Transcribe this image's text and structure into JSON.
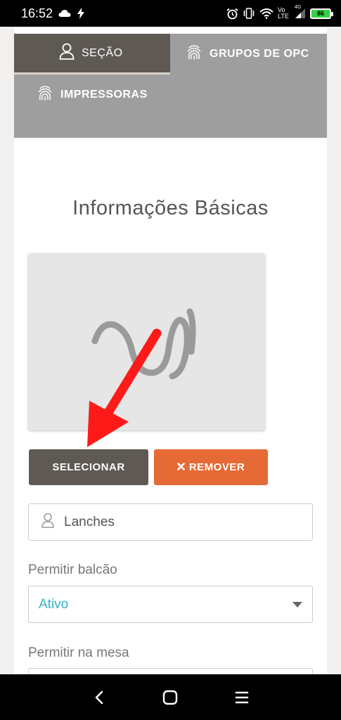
{
  "status_bar": {
    "time": "16:52",
    "network_label": "Vo LTE",
    "network_type": "4G",
    "battery": "86"
  },
  "tabs": {
    "secao": "SEÇÃO",
    "grupos": "GRUPOS DE OPC",
    "impressoras": "IMPRESSORAS"
  },
  "main": {
    "title": "Informações Básicas",
    "select_button": "SELECIONAR",
    "remove_button": "REMOVER",
    "name_value": "Lanches",
    "permitir_balcao_label": "Permitir balcão",
    "permitir_balcao_value": "Ativo",
    "permitir_mesa_label": "Permitir na mesa",
    "permitir_mesa_value": ""
  },
  "colors": {
    "tab_active": "#5f5953",
    "tab_bar": "#9e9e9e",
    "select_button": "#5f5953",
    "remove_button": "#e66a35",
    "select_value": "#3ab1c8",
    "annotation_arrow": "#ff1a1a"
  },
  "icons": [
    "cloud-icon",
    "flash-icon",
    "alarm-icon",
    "vibrate-icon",
    "wifi-icon",
    "signal-icon",
    "battery-icon",
    "user-icon",
    "fingerprint-icon",
    "image-placeholder-icon",
    "close-icon",
    "back-icon",
    "home-icon",
    "recents-icon"
  ]
}
